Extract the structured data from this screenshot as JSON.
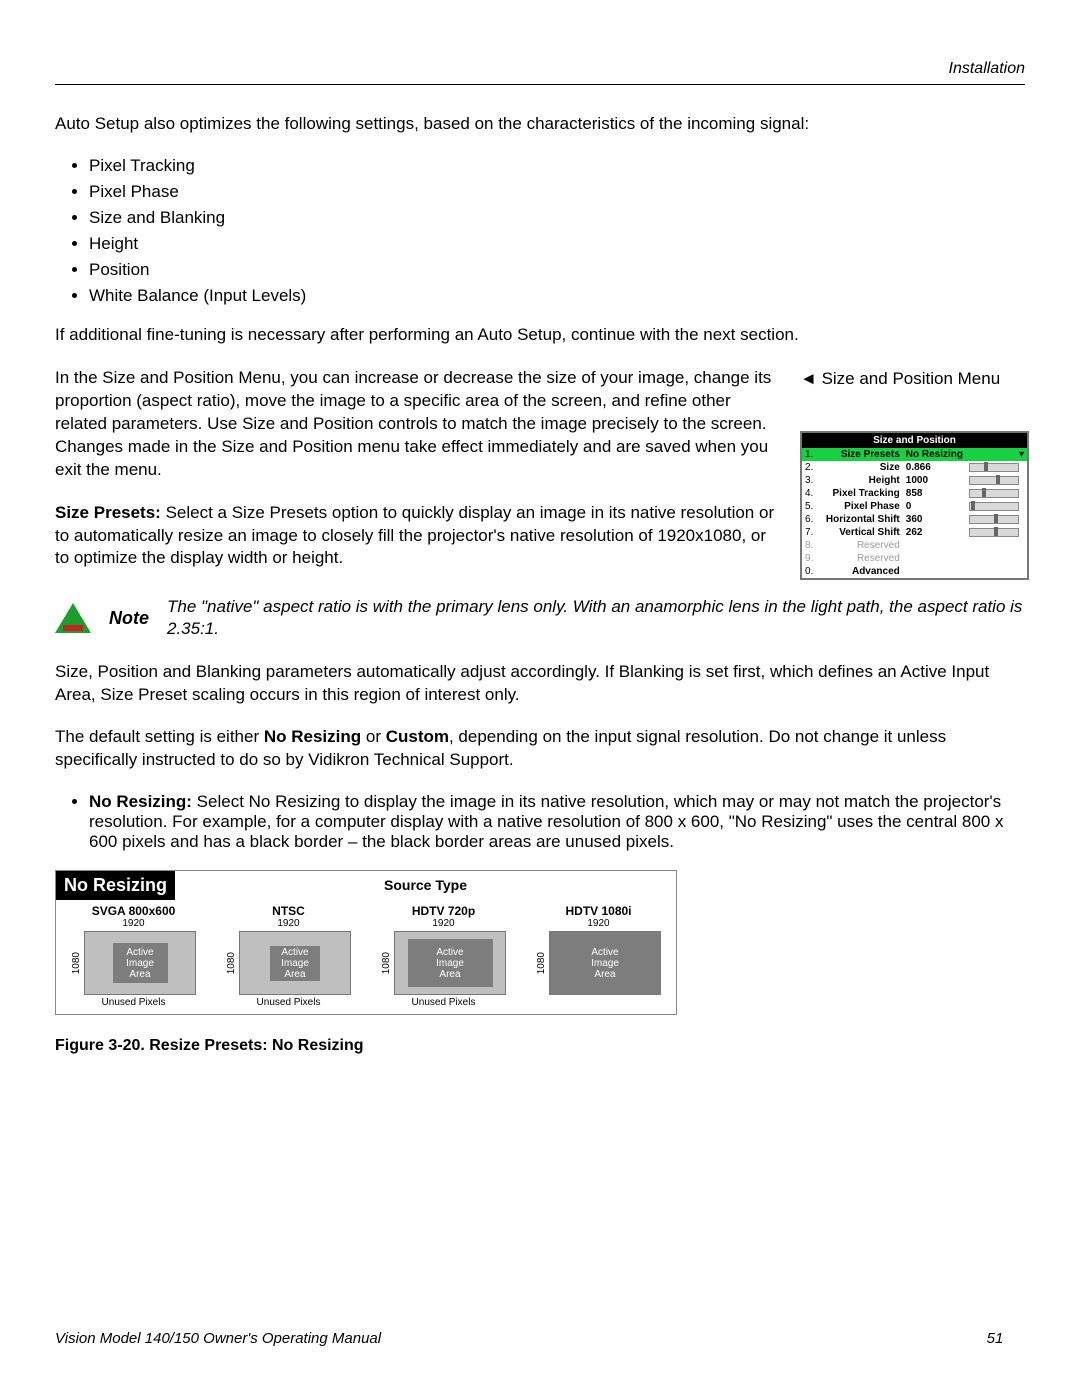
{
  "header": {
    "section": "Installation"
  },
  "intro": {
    "lead": "Auto Setup also optimizes the following settings, based on the characteristics of the incoming signal:",
    "bullets": [
      "Pixel Tracking",
      "Pixel Phase",
      "Size and Blanking",
      "Height",
      "Position",
      "White Balance (Input Levels)"
    ],
    "after": "If additional fine-tuning is necessary after performing an Auto Setup, continue with the next section."
  },
  "sizepos": {
    "side_heading": "Size and Position Menu",
    "para1": "In the Size and Position Menu, you can increase or decrease the size of your image, change its proportion (aspect ratio), move the image to a specific area of the screen, and refine other related parameters. Use Size and Position controls to match the image precisely to the screen. Changes made in the Size and Position menu take effect immediately and are saved when you exit the menu.",
    "presets_label": "Size Presets:",
    "presets_text": " Select a Size Presets option to quickly display an image in its native resolution or to automatically resize an image to closely fill the projector's native resolution of 1920x1080, or to optimize the display width or height."
  },
  "osd": {
    "title": "Size and Position",
    "rows": [
      {
        "idx": "1.",
        "label": "Size Presets",
        "value": "No Resizing",
        "selected": true
      },
      {
        "idx": "2.",
        "label": "Size",
        "value": "0.866",
        "bar": 30
      },
      {
        "idx": "3.",
        "label": "Height",
        "value": "1000",
        "bar": 55
      },
      {
        "idx": "4.",
        "label": "Pixel Tracking",
        "value": "858",
        "bar": 25
      },
      {
        "idx": "5.",
        "label": "Pixel Phase",
        "value": "0",
        "bar": 2
      },
      {
        "idx": "6.",
        "label": "Horizontal Shift",
        "value": "360",
        "bar": 50
      },
      {
        "idx": "7.",
        "label": "Vertical Shift",
        "value": "262",
        "bar": 50
      },
      {
        "idx": "8.",
        "label": "Reserved",
        "muted": true
      },
      {
        "idx": "9.",
        "label": "Reserved",
        "muted": true
      },
      {
        "idx": "0.",
        "label": "Advanced"
      }
    ]
  },
  "note": {
    "label": "Note",
    "text": "The \"native\" aspect ratio is with the primary lens only. With an anamorphic lens in the light path, the aspect ratio is 2.35:1."
  },
  "after_note": {
    "p1": "Size, Position and Blanking parameters automatically adjust accordingly. If Blanking is set first, which defines an Active Input Area, Size Preset scaling occurs in this region of interest only.",
    "p2a": "The default setting is either ",
    "p2b": "No Resizing",
    "p2c": " or ",
    "p2d": "Custom",
    "p2e": ", depending on the input signal resolution. Do not change it unless specifically instructed to do so by Vidikron Technical Support.",
    "nr_label": "No Resizing:",
    "nr_text": " Select No Resizing to display the image in its native resolution, which may or may not match the projector's resolution. For example, for a computer display with a native resolution of 800 x 600, \"No Resizing\" uses the central 800 x 600 pixels and has a black border – the black border areas are unused pixels."
  },
  "figure": {
    "badge": "No Resizing",
    "source_type": "Source Type",
    "cols": [
      {
        "name": "SVGA 800x600",
        "w": "1920",
        "h": "1080",
        "inner_w": 55,
        "inner_h": 40,
        "unused": "Unused Pixels"
      },
      {
        "name": "NTSC",
        "w": "1920",
        "h": "1080",
        "inner_w": 50,
        "inner_h": 35,
        "unused": "Unused Pixels"
      },
      {
        "name": "HDTV 720p",
        "w": "1920",
        "h": "1080",
        "inner_w": 85,
        "inner_h": 48,
        "unused": "Unused Pixels"
      },
      {
        "name": "HDTV 1080i",
        "w": "1920",
        "h": "1080",
        "inner_w": 110,
        "inner_h": 62,
        "unused": ""
      }
    ],
    "active_label": "Active\nImage\nArea",
    "caption": "Figure 3-20. Resize Presets: No Resizing"
  },
  "footer": {
    "manual": "Vision Model 140/150 Owner's Operating Manual",
    "page": "51"
  }
}
